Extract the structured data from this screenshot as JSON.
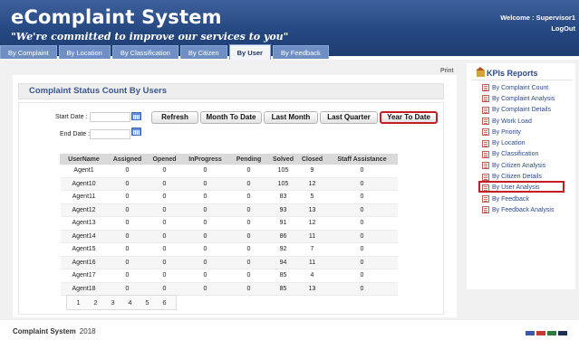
{
  "header": {
    "title": "eComplaint System",
    "slogan": "\"We're committed to improve our services to you\"",
    "welcome": "Welcome : Supervisor1",
    "logout": "LogOut"
  },
  "tabs": [
    {
      "label": "By Complaint",
      "active": false
    },
    {
      "label": "By Location",
      "active": false
    },
    {
      "label": "By Classification",
      "active": false
    },
    {
      "label": "By Citizen",
      "active": false
    },
    {
      "label": "By User",
      "active": true
    },
    {
      "label": "By Feedback",
      "active": false
    }
  ],
  "main": {
    "print": "Print",
    "panel_title": "Complaint Status Count By Users",
    "start_label": "Start Date :",
    "end_label": "End Date :",
    "start_value": "",
    "end_value": "",
    "buttons": {
      "refresh": "Refresh",
      "month": "Month To Date",
      "last_month": "Last Month",
      "last_quarter": "Last Quarter",
      "year": "Year To Date"
    },
    "selected_button": "Year To Date"
  },
  "table": {
    "columns": [
      "UserName",
      "Assigned",
      "Opened",
      "InProgress",
      "Pending",
      "Solved",
      "Closed",
      "Staff Assistance"
    ],
    "rows": [
      [
        "Agent1",
        "0",
        "0",
        "0",
        "0",
        "105",
        "9",
        "0"
      ],
      [
        "Agent10",
        "0",
        "0",
        "0",
        "0",
        "105",
        "12",
        "0"
      ],
      [
        "Agent11",
        "0",
        "0",
        "0",
        "0",
        "83",
        "5",
        "0"
      ],
      [
        "Agent12",
        "0",
        "0",
        "0",
        "0",
        "93",
        "13",
        "0"
      ],
      [
        "Agent13",
        "0",
        "0",
        "0",
        "0",
        "91",
        "12",
        "0"
      ],
      [
        "Agent14",
        "0",
        "0",
        "0",
        "0",
        "86",
        "11",
        "0"
      ],
      [
        "Agent15",
        "0",
        "0",
        "0",
        "0",
        "92",
        "7",
        "0"
      ],
      [
        "Agent16",
        "0",
        "0",
        "0",
        "0",
        "94",
        "11",
        "0"
      ],
      [
        "Agent17",
        "0",
        "0",
        "0",
        "0",
        "85",
        "4",
        "0"
      ],
      [
        "Agent18",
        "0",
        "0",
        "0",
        "0",
        "85",
        "13",
        "0"
      ]
    ],
    "pages": [
      "1",
      "2",
      "3",
      "4",
      "5",
      "6"
    ]
  },
  "sidebar": {
    "title": "KPIs Reports",
    "items": [
      "By Complaint Count",
      "By Complaint Analysis",
      "By Complaint Details",
      "By Work Load",
      "By Priority",
      "By Location",
      "By Classification",
      "By Citizen Analysis",
      "By Citizen Details",
      "By User Analysis",
      "By Feedback",
      "By Feedback Analysis"
    ],
    "highlighted": "By User Analysis"
  },
  "footer": {
    "text": "Complaint System",
    "year": "2018",
    "swatch_colors": [
      "#3a5aa8",
      "#c33a2e",
      "#2f7a3b",
      "#1f2f55"
    ]
  },
  "colors": {
    "header": "#24467f",
    "highlight": "#c41e24"
  }
}
